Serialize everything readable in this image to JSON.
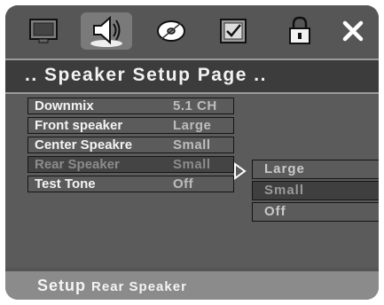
{
  "icons": [
    {
      "name": "tv-icon",
      "selected": false
    },
    {
      "name": "speaker-icon",
      "selected": true
    },
    {
      "name": "disc-icon",
      "selected": false
    },
    {
      "name": "preferences-icon",
      "selected": false
    },
    {
      "name": "lock-icon",
      "selected": false
    },
    {
      "name": "close-icon",
      "selected": false
    }
  ],
  "title": ".. Speaker Setup Page ..",
  "menu": [
    {
      "label": "Downmix",
      "value": "5.1 CH"
    },
    {
      "label": "Front speaker",
      "value": "Large"
    },
    {
      "label": "Center Speakre",
      "value": "Small"
    },
    {
      "label": "Rear Speaker",
      "value": "Small",
      "active": true
    },
    {
      "label": "Test Tone",
      "value": "Off"
    }
  ],
  "submenu": [
    {
      "label": "Large",
      "selected": false
    },
    {
      "label": "Small",
      "selected": true
    },
    {
      "label": "Off",
      "selected": false
    }
  ],
  "status": {
    "prefix": "Setup",
    "item": "Rear Speaker"
  },
  "colors": {
    "frame": "#555555",
    "title_bar": "#3c3c3c",
    "status_bar": "#8b8b8b",
    "text": "#f4f4f4"
  }
}
